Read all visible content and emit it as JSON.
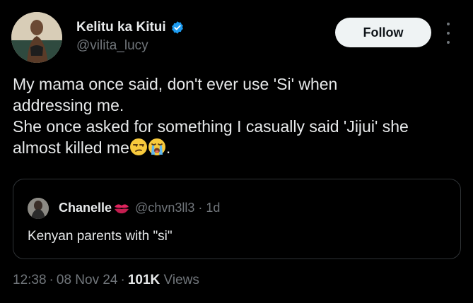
{
  "author": {
    "name": "Kelitu ka Kitui",
    "handle": "@vilita_lucy",
    "verified_icon": "verified-badge-icon",
    "verified_color": "#1d9bf0"
  },
  "follow": {
    "label": "Follow"
  },
  "more": {
    "icon": "more-vertical-icon"
  },
  "tweet": {
    "line1": "My mama once said, don't ever use 'Si' when",
    "line2": "addressing me.",
    "line3": "She once asked for something I casually said 'Jijui' she",
    "line4": "almost killed me",
    "line4_end": ".",
    "emojis": [
      "unamused-face-icon",
      "loudly-crying-face-icon"
    ]
  },
  "quote": {
    "name": "Chanelle",
    "name_icon": "kiss-mark-icon",
    "handle": "@chvn3ll3",
    "separator": "·",
    "time": "1d",
    "text": "Kenyan parents with \"si\""
  },
  "meta": {
    "time": "12:38",
    "date": "08 Nov 24",
    "views": "101K",
    "views_label": "Views",
    "separator": "·"
  },
  "colors": {
    "background": "#000000",
    "text": "#e7e9ea",
    "muted": "#71767b",
    "border": "#2f3336",
    "follow_bg": "#eff3f4"
  }
}
